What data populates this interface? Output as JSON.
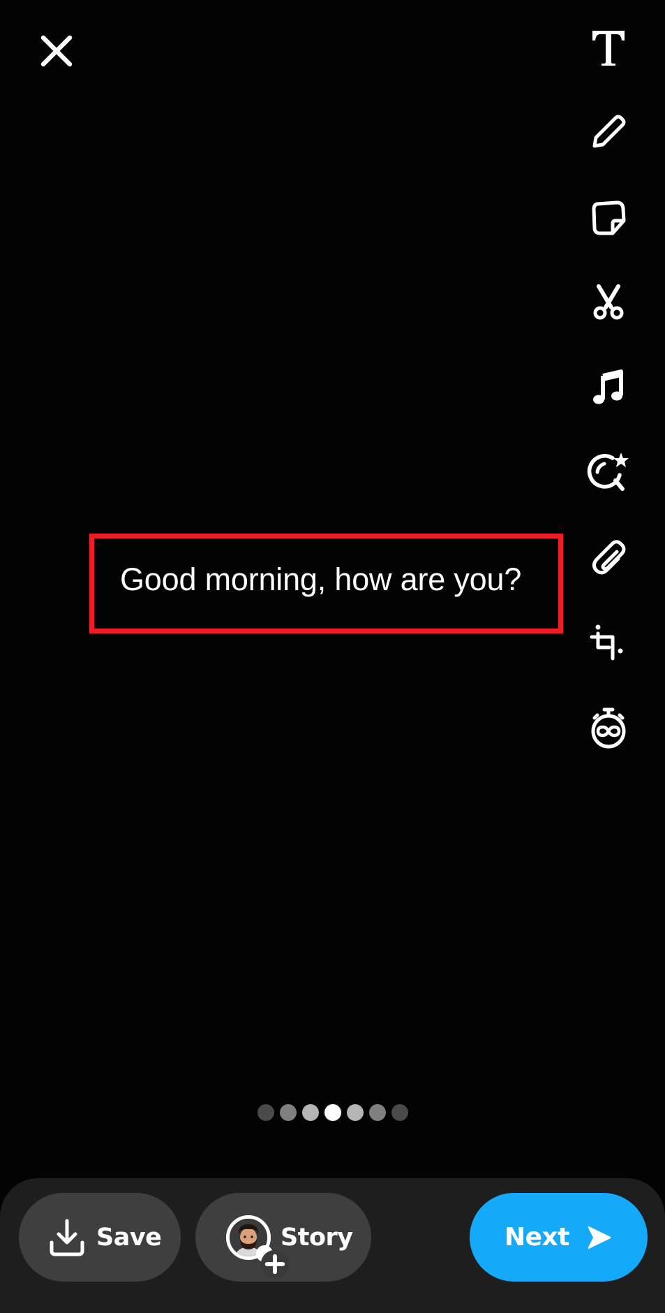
{
  "screen": {
    "background_color": "#030303"
  },
  "header": {
    "close_icon": "close-icon"
  },
  "toolbar": {
    "tools": [
      {
        "name": "text",
        "icon": "text-icon"
      },
      {
        "name": "draw",
        "icon": "pencil-icon"
      },
      {
        "name": "sticker",
        "icon": "sticker-icon"
      },
      {
        "name": "scissors",
        "icon": "scissors-icon"
      },
      {
        "name": "music",
        "icon": "music-note-icon"
      },
      {
        "name": "lens",
        "icon": "lens-search-star-icon"
      },
      {
        "name": "attachment",
        "icon": "paperclip-icon"
      },
      {
        "name": "crop",
        "icon": "crop-icon"
      },
      {
        "name": "timer",
        "icon": "timer-infinity-icon"
      }
    ]
  },
  "canvas": {
    "caption_text": "Good morning, how are you?",
    "highlight_color": "#ee1c24"
  },
  "page_indicator": {
    "count": 7,
    "active_index": 3,
    "dot_colors": [
      "#4a4a4a",
      "#808080",
      "#b5b5b5",
      "#ffffff",
      "#b5b5b5",
      "#808080",
      "#4a4a4a"
    ]
  },
  "bottom_bar": {
    "save": {
      "label": "Save",
      "icon": "download-icon"
    },
    "story": {
      "label": "Story",
      "icon": "avatar-add-icon"
    },
    "next": {
      "label": "Next",
      "icon": "send-arrow-icon",
      "color": "#14a9f9"
    }
  }
}
